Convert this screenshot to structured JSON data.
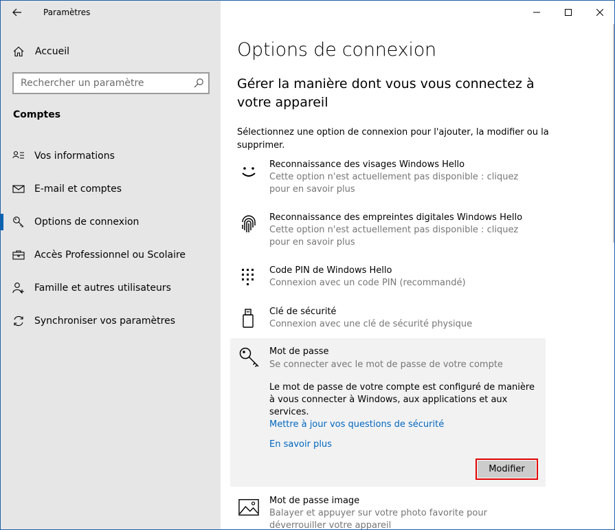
{
  "app": {
    "title": "Paramètres"
  },
  "sidebar": {
    "home_label": "Accueil",
    "search_placeholder": "Rechercher un paramètre",
    "section_title": "Comptes",
    "items": [
      {
        "label": "Vos informations",
        "icon": "person-card-icon"
      },
      {
        "label": "E-mail et comptes",
        "icon": "mail-icon"
      },
      {
        "label": "Options de connexion",
        "icon": "key-icon",
        "active": true
      },
      {
        "label": "Accès Professionnel ou Scolaire",
        "icon": "briefcase-icon"
      },
      {
        "label": "Famille et autres utilisateurs",
        "icon": "person-add-icon"
      },
      {
        "label": "Synchroniser vos paramètres",
        "icon": "sync-icon"
      }
    ]
  },
  "main": {
    "title": "Options de connexion",
    "subtitle": "Gérer la manière dont vous vous connectez à votre appareil",
    "intro": "Sélectionnez une option de connexion pour l'ajouter, la modifier ou la supprimer.",
    "options": [
      {
        "title": "Reconnaissance des visages Windows Hello",
        "desc": "Cette option n'est actuellement pas disponible : cliquez pour en savoir plus",
        "icon": "face-icon"
      },
      {
        "title": "Reconnaissance des empreintes digitales Windows Hello",
        "desc": "Cette option n'est actuellement pas disponible : cliquez pour en savoir plus",
        "icon": "fingerprint-icon"
      },
      {
        "title": "Code PIN de Windows Hello",
        "desc": "Connexion avec un code PIN (recommandé)",
        "icon": "pin-keypad-icon"
      },
      {
        "title": "Clé de sécurité",
        "desc": "Connexion avec une clé de sécurité physique",
        "icon": "usb-key-icon"
      }
    ],
    "password": {
      "title": "Mot de passe",
      "desc": "Se connecter avec le mot de passe de votre compte",
      "info": "Le mot de passe de votre compte est configuré de manière à vous connecter à Windows, aux applications et aux services.",
      "link_security": "Mettre à jour vos questions de sécurité",
      "link_learn": "En savoir plus",
      "button": "Modifier"
    },
    "picture_password": {
      "title": "Mot de passe image",
      "desc": "Balayer et appuyer sur votre photo favorite pour déverrouiller votre appareil",
      "icon": "picture-icon"
    }
  },
  "colors": {
    "accent": "#0063b1",
    "link": "#0067c0",
    "highlight_border": "#e00000"
  }
}
